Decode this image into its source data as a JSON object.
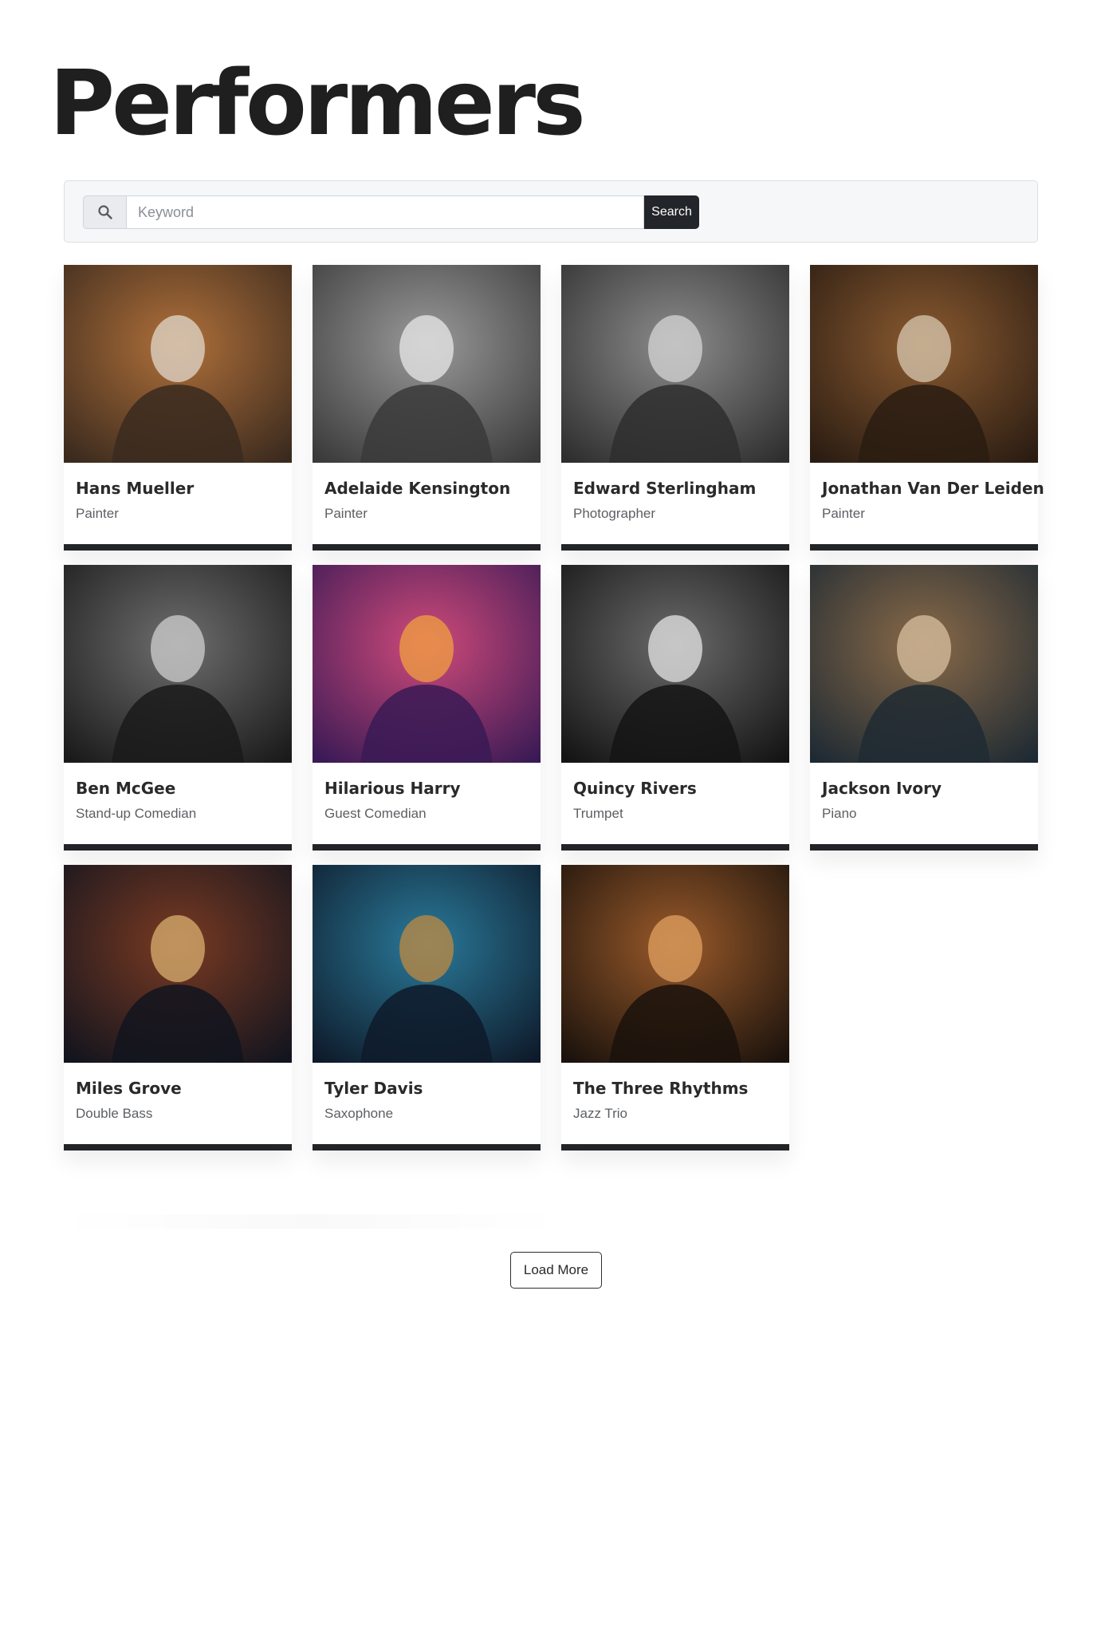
{
  "page": {
    "title": "Performers"
  },
  "search": {
    "icon": "search-icon",
    "placeholder": "Keyword",
    "value": "",
    "button_label": "Search"
  },
  "performers": [
    {
      "name": "Hans Mueller",
      "role": "Painter",
      "palette": [
        "#3a2a1e",
        "#b0703a",
        "#e0d8cc"
      ]
    },
    {
      "name": "Adelaide Kensington",
      "role": "Painter",
      "palette": [
        "#3a3a3a",
        "#9a9a9a",
        "#e8e8e8"
      ]
    },
    {
      "name": "Edward Sterlingham",
      "role": "Photographer",
      "palette": [
        "#2e2e2e",
        "#8c8c8c",
        "#d6d6d6"
      ]
    },
    {
      "name": "Jonathan Van Der Leiden",
      "role": "Painter",
      "palette": [
        "#2a1c12",
        "#8a5a30",
        "#d8c8b0"
      ]
    },
    {
      "name": "Ben McGee",
      "role": "Stand-up Comedian",
      "palette": [
        "#1a1a1a",
        "#6e6e6e",
        "#cfcfcf"
      ]
    },
    {
      "name": "Hilarious Harry",
      "role": "Guest Comedian",
      "palette": [
        "#3a1a55",
        "#d04a7a",
        "#f0a040"
      ]
    },
    {
      "name": "Quincy Rivers",
      "role": "Trumpet",
      "palette": [
        "#141414",
        "#6a6a6a",
        "#e6e6e6"
      ]
    },
    {
      "name": "Jackson Ivory",
      "role": "Piano",
      "palette": [
        "#1e2a33",
        "#8a6a48",
        "#d8c0a0"
      ]
    },
    {
      "name": "Miles Grove",
      "role": "Double Bass",
      "palette": [
        "#12141e",
        "#7a3a22",
        "#d9b070"
      ]
    },
    {
      "name": "Tyler Davis",
      "role": "Saxophone",
      "palette": [
        "#0e1a2a",
        "#2a7a9a",
        "#c08a40"
      ]
    },
    {
      "name": "The Three Rhythms",
      "role": "Jazz Trio",
      "palette": [
        "#1a120c",
        "#9a5a2a",
        "#e0a060"
      ]
    }
  ],
  "footer": {
    "load_more_label": "Load More"
  }
}
